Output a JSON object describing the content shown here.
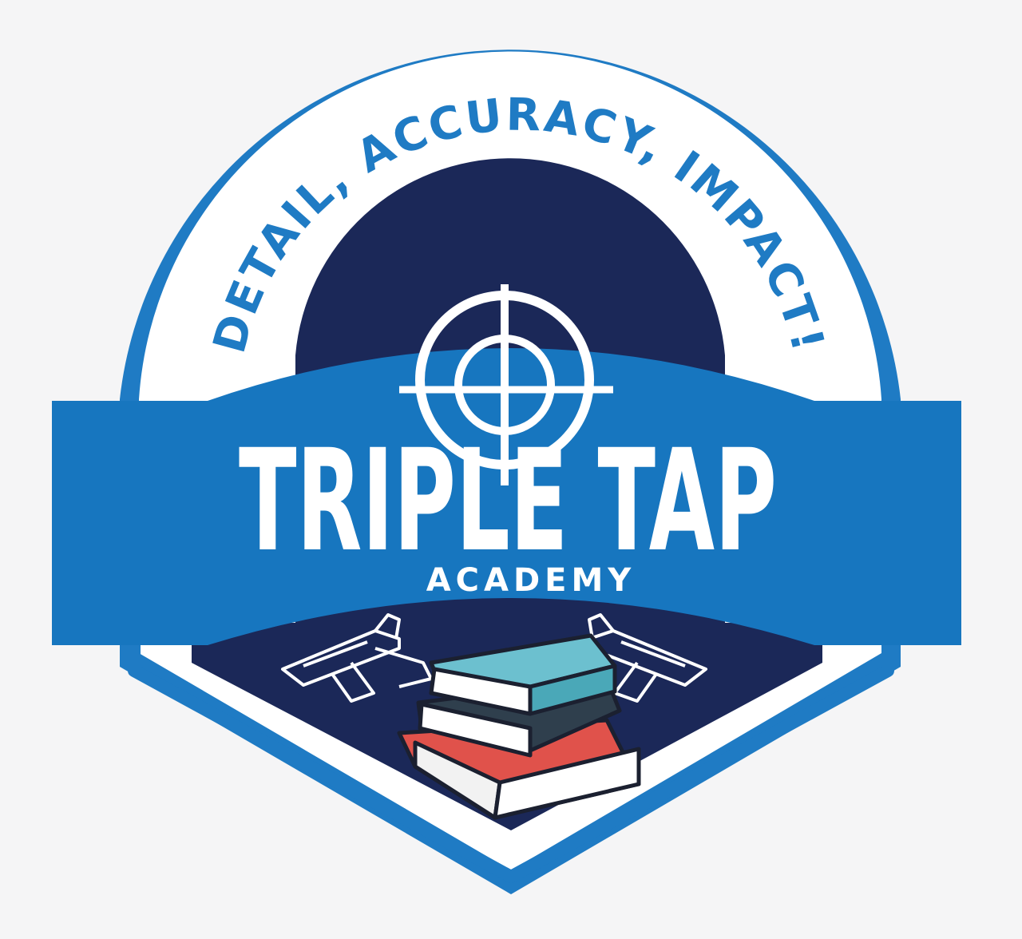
{
  "logo": {
    "motto": "DETAIL, ACCURACY, IMPACT!",
    "name": "TRIPLE TAP",
    "subtitle": "ACADEMY"
  },
  "icons": {
    "target": "crosshair-icon",
    "weapons": [
      "pistol-left-icon",
      "pistol-right-icon"
    ],
    "books": "book-stack-icon"
  },
  "colors": {
    "background": "#f5f5f6",
    "outer_blue": "#1f7bc4",
    "banner_blue": "#1776bf",
    "navy": "#1b2858",
    "white": "#ffffff",
    "book_teal": "#6cc0cf",
    "book_dark": "#2f3f4d",
    "book_red": "#e0524b"
  }
}
